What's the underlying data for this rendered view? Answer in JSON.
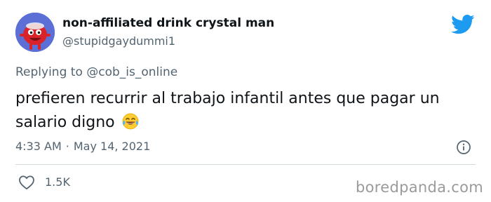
{
  "author": {
    "display_name": "non-affiliated drink crystal man",
    "handle": "@stupidgaydummi1",
    "avatar_icon": "kool-aid-man-avatar-icon"
  },
  "reply": {
    "prefix": "Replying to ",
    "mention": "@cob_is_online"
  },
  "tweet": {
    "text": "prefieren recurrir al trabajo infantil antes que pagar un salario digno",
    "emoji_icon": "face-with-tears-of-joy-icon"
  },
  "meta": {
    "time": "4:33 AM",
    "separator": "·",
    "date": "May 14, 2021"
  },
  "actions": {
    "like_count": "1.5K"
  },
  "watermark": "boredpanda.com",
  "colors": {
    "twitter_blue": "#1d9bf0",
    "secondary_text": "#536471",
    "avatar_bg": "#5b6fd6",
    "kool_aid_red": "#d8232a"
  }
}
